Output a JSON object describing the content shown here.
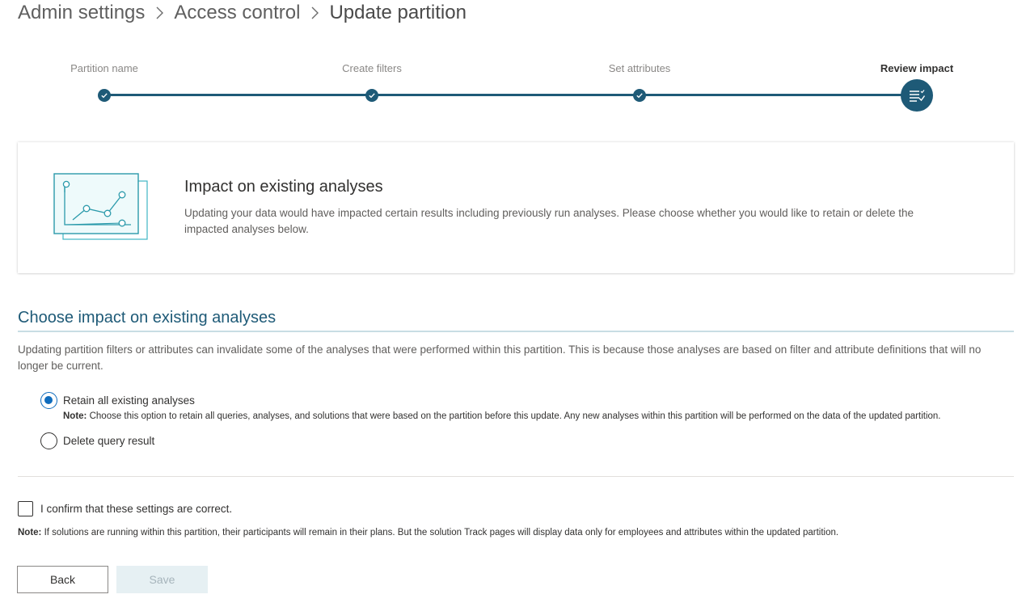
{
  "breadcrumb": {
    "items": [
      "Admin settings",
      "Access control"
    ],
    "current": "Update partition"
  },
  "stepper": {
    "steps": [
      {
        "label": "Partition name",
        "state": "complete"
      },
      {
        "label": "Create filters",
        "state": "complete"
      },
      {
        "label": "Set attributes",
        "state": "complete"
      },
      {
        "label": "Review impact",
        "state": "current"
      }
    ],
    "accent_color": "#1e5a77"
  },
  "impact_card": {
    "illustration": "chart-analysis-icon",
    "title": "Impact on existing analyses",
    "description": "Updating your data would have impacted certain results including previously run analyses. Please choose whether you would like to retain or delete the impacted analyses below."
  },
  "choose_section": {
    "title": "Choose impact on existing analyses",
    "description": "Updating partition filters or attributes can invalidate some of the analyses that were performed within this partition. This is because those analyses are based on filter and attribute definitions that will no longer be current.",
    "options": [
      {
        "label": "Retain all existing analyses",
        "selected": true,
        "note_prefix": "Note:",
        "note": "Choose this option to retain all queries, analyses, and solutions that were based on the partition before this update. Any new analyses within this partition will be performed on the data of the updated partition."
      },
      {
        "label": "Delete query result",
        "selected": false
      }
    ]
  },
  "confirm": {
    "label": "I confirm that these settings are correct.",
    "checked": false
  },
  "bottom_note": {
    "prefix": "Note:",
    "text": "If solutions are running within this partition, their participants will remain in their plans. But the solution Track pages will display data only for employees and attributes within the updated partition."
  },
  "actions": {
    "back_label": "Back",
    "save_label": "Save",
    "save_enabled": false
  }
}
